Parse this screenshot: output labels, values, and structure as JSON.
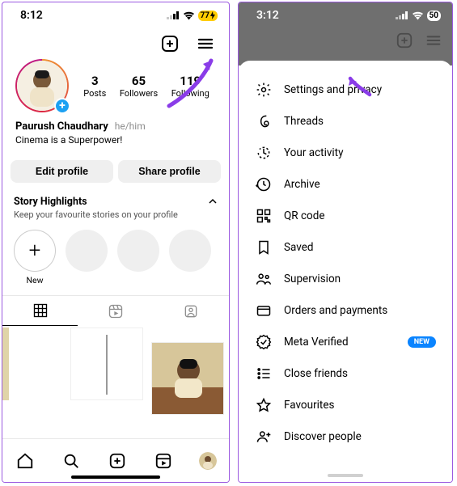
{
  "left": {
    "status": {
      "time": "8:12",
      "battery": "77"
    },
    "profile": {
      "posts_count": "3",
      "posts_label": "Posts",
      "followers_count": "65",
      "followers_label": "Followers",
      "following_count": "119",
      "following_label": "Following",
      "display_name": "Paurush Chaudhary",
      "pronouns": "he/him",
      "bio": "Cinema is a Superpower!",
      "edit_btn": "Edit profile",
      "share_btn": "Share profile"
    },
    "highlights": {
      "title": "Story Highlights",
      "subtitle": "Keep your favourite stories on your profile",
      "new_label": "New"
    }
  },
  "right": {
    "status": {
      "time": "3:12",
      "battery": "50"
    },
    "menu": {
      "settings": "Settings and privacy",
      "threads": "Threads",
      "activity": "Your activity",
      "archive": "Archive",
      "qrcode": "QR code",
      "saved": "Saved",
      "supervision": "Supervision",
      "orders": "Orders and payments",
      "meta": "Meta Verified",
      "meta_badge": "NEW",
      "close_friends": "Close friends",
      "favourites": "Favourites",
      "discover": "Discover people"
    }
  }
}
